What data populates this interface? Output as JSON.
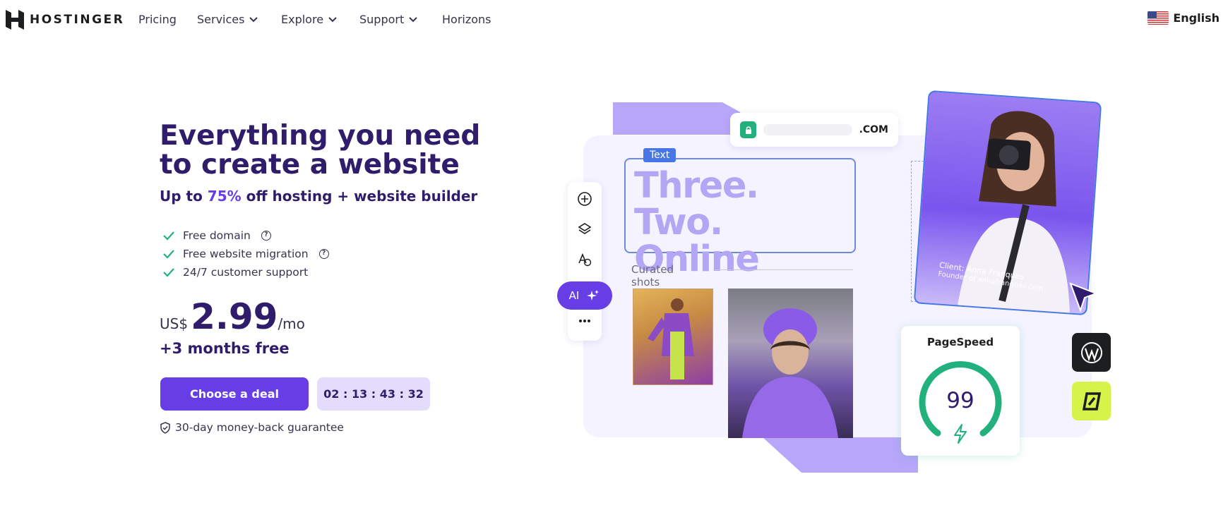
{
  "nav": {
    "brand": "HOSTINGER",
    "items": [
      {
        "label": "Pricing",
        "has_dropdown": false
      },
      {
        "label": "Services",
        "has_dropdown": true
      },
      {
        "label": "Explore",
        "has_dropdown": true
      },
      {
        "label": "Support",
        "has_dropdown": true
      },
      {
        "label": "Horizons",
        "has_dropdown": false
      }
    ],
    "language": "English"
  },
  "hero": {
    "title": "Everything you need to create a website",
    "subtitle_prefix": "Up to ",
    "subtitle_pct": "75%",
    "subtitle_suffix": " off hosting + website builder",
    "features": [
      {
        "label": "Free domain",
        "help": true
      },
      {
        "label": "Free website migration",
        "help": true
      },
      {
        "label": "24/7 customer support",
        "help": false
      }
    ],
    "price": {
      "currency": "US$",
      "amount": "2.99",
      "period": "/mo"
    },
    "bonus": "+3 months free",
    "cta_label": "Choose a deal",
    "timer": "02 : 13 : 43 : 32",
    "guarantee": "30-day money-back guarantee"
  },
  "illustration": {
    "url_suffix": ".COM",
    "text_tag": "Text",
    "headline_line1": "Three. Two.",
    "headline_line2": "Online",
    "ai_label": "AI",
    "curated_label": "Curated shots",
    "client_name": "Client: Anna Franques",
    "client_role": "Founder of annafranques.com",
    "pagespeed_label": "PageSpeed",
    "pagespeed_score": "99",
    "colors": {
      "primary": "#673de6",
      "dark": "#2f1c6a",
      "accent_green": "#22b07d",
      "lime": "#d6f34a"
    }
  }
}
